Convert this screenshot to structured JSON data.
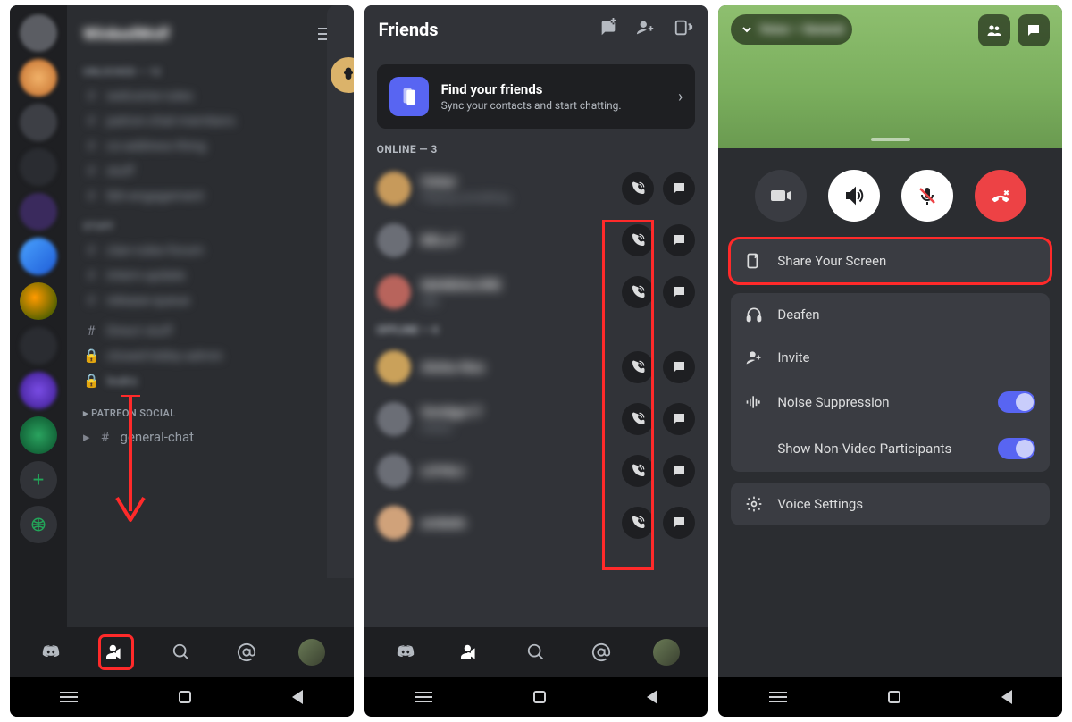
{
  "screen1": {
    "server_title": "WinkedWolf",
    "categories": [
      "UNLOCKED — 12",
      "STUFF"
    ],
    "channels_blur": [
      "welcome-rules",
      "patron-chat-members",
      "co-address-thing",
      "stuff",
      "tbh-engagement",
      "clan-rules-forum",
      "intern-update",
      "release-queue"
    ],
    "channels_locked": [
      "Direct stuff",
      "closed-lobby-admin",
      "leaks"
    ],
    "category_clear": "PATREON SOCIAL",
    "channel_clear": "general-chat",
    "bottom_tabs": [
      "discord",
      "friends",
      "search",
      "mentions",
      "profile"
    ]
  },
  "screen2": {
    "title": "Friends",
    "find_title": "Find your friends",
    "find_sub": "Sync your contacts and start chatting.",
    "online_header": "ONLINE — 3",
    "friends": [
      {
        "name": "Oskar",
        "status": "Playing something",
        "avatar": "#c79a5b"
      },
      {
        "name": "BELu7",
        "status": "",
        "avatar": "#6b6e76"
      },
      {
        "name": "MANDALORE",
        "status": "Idle",
        "avatar": "#b8645c"
      },
      {
        "name": "Aloha-Nox",
        "status": "",
        "avatar": "#caa15a"
      },
      {
        "name": "Smidge17",
        "status": "Online",
        "avatar": "#6b6e76"
      },
      {
        "name": "LOYALI",
        "status": "",
        "avatar": "#6b6e76"
      },
      {
        "name": "andado",
        "status": "",
        "avatar": "#d0a27a"
      }
    ]
  },
  "screen3": {
    "header_name": "Voice — General",
    "share_label": "Share Your Screen",
    "deafen_label": "Deafen",
    "invite_label": "Invite",
    "noise_label": "Noise Suppression",
    "nonvideo_label": "Show Non-Video Participants",
    "voice_settings_label": "Voice Settings",
    "noise_on": true,
    "nonvideo_on": true
  }
}
